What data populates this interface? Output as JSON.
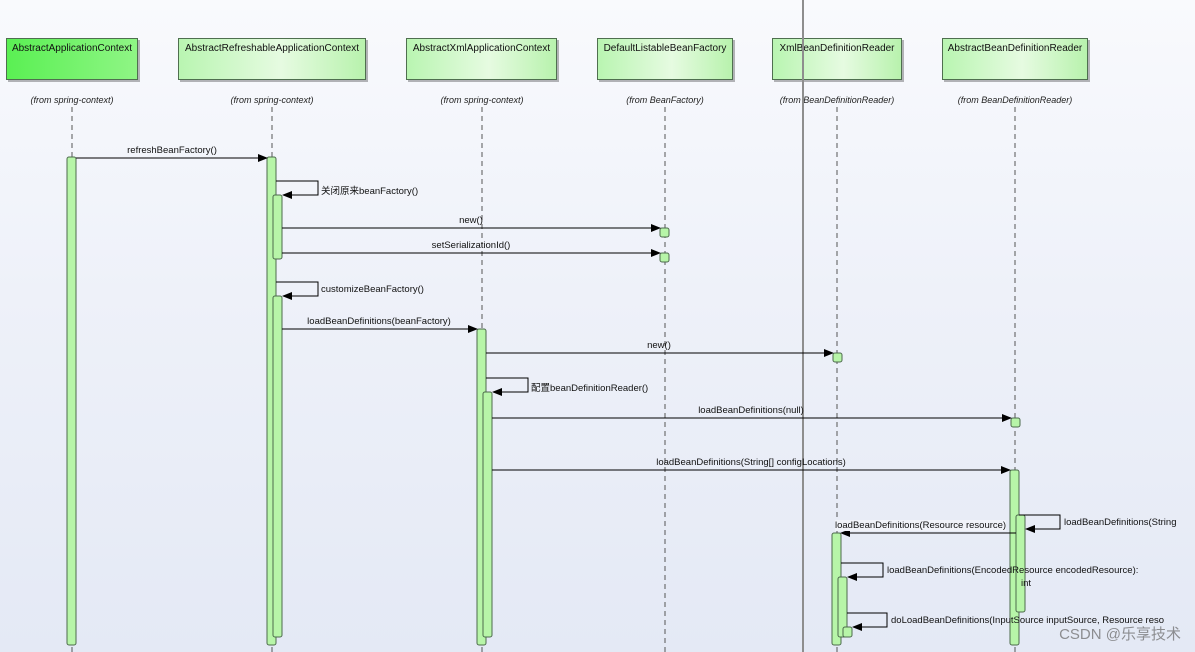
{
  "lifelines": [
    {
      "id": "aac",
      "name": "AbstractApplicationContext",
      "from": "(from spring-context)"
    },
    {
      "id": "arac",
      "name": "AbstractRefreshableApplicationContext",
      "from": "(from spring-context)"
    },
    {
      "id": "axac",
      "name": "AbstractXmlApplicationContext",
      "from": "(from spring-context)"
    },
    {
      "id": "dlbf",
      "name": "DefaultListableBeanFactory",
      "from": "(from BeanFactory)"
    },
    {
      "id": "xbdr",
      "name": "XmlBeanDefinitionReader",
      "from": "(from BeanDefinitionReader)"
    },
    {
      "id": "abdr",
      "name": "AbstractBeanDefinitionReader",
      "from": "(from BeanDefinitionReader)"
    }
  ],
  "messages": [
    {
      "id": "m1",
      "label": "refreshBeanFactory()"
    },
    {
      "id": "m2",
      "label": "关闭原来beanFactory()"
    },
    {
      "id": "m3",
      "label": "new()"
    },
    {
      "id": "m4",
      "label": "setSerializationId()"
    },
    {
      "id": "m5",
      "label": "customizeBeanFactory()"
    },
    {
      "id": "m6",
      "label": "loadBeanDefinitions(beanFactory)"
    },
    {
      "id": "m7",
      "label": "new()"
    },
    {
      "id": "m8",
      "label": "配置beanDefinitionReader()"
    },
    {
      "id": "m9",
      "label": "loadBeanDefinitions(null)"
    },
    {
      "id": "m10",
      "label": "loadBeanDefinitions(String[] configLocations)"
    },
    {
      "id": "m11",
      "label": "loadBeanDefinitions(String"
    },
    {
      "id": "m12",
      "label": "loadBeanDefinitions(Resource resource)"
    },
    {
      "id": "m13",
      "label": "loadBeanDefinitions(EncodedResource encodedResource):"
    },
    {
      "id": "m13r",
      "label": "int"
    },
    {
      "id": "m14",
      "label": "doLoadBeanDefinitions(InputSource inputSource, Resource reso"
    }
  ],
  "watermark": "CSDN @乐享技术",
  "colors": {
    "activation": "#b7f5a8",
    "activation_border": "#4c6a4c",
    "lifeline": "#555555",
    "arrow": "#000000",
    "separator": "#8e8e8e"
  }
}
